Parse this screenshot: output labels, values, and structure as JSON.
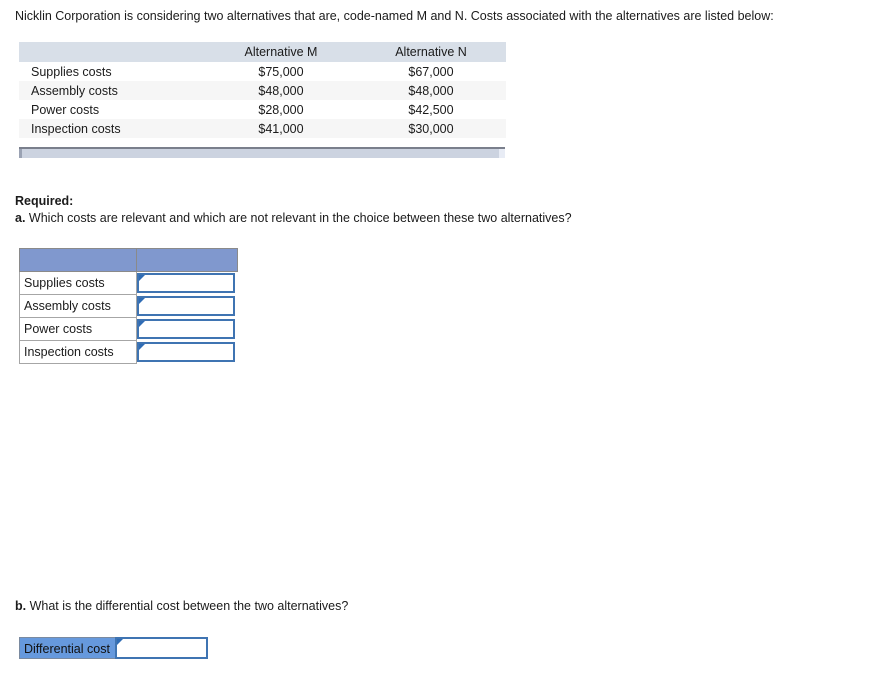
{
  "intro": {
    "text": "Nicklin Corporation is considering two alternatives that are, code-named M and N. Costs associated with the alternatives are listed below:"
  },
  "data_table": {
    "columns": [
      "",
      "Alternative M",
      "Alternative N"
    ],
    "rows": [
      {
        "label": "Supplies costs",
        "m": "$75,000",
        "n": "$67,000"
      },
      {
        "label": "Assembly costs",
        "m": "$48,000",
        "n": "$48,000"
      },
      {
        "label": "Power costs",
        "m": "$28,000",
        "n": "$42,500"
      },
      {
        "label": "Inspection costs",
        "m": "$41,000",
        "n": "$30,000"
      }
    ]
  },
  "scrollbar": {
    "name": "horizontal-scrollbar"
  },
  "required": {
    "heading": "Required:",
    "question_a_letter": "a.",
    "question_a_text": " Which costs are relevant and which are not relevant in the choice between these two alternatives?",
    "question_b_letter": "b.",
    "question_b_text": " What is the differential cost between the two alternatives?"
  },
  "answer_table": {
    "header": {
      "col1": "",
      "col2": ""
    },
    "rows": [
      {
        "label": "Supplies costs",
        "value": "",
        "placeholder": ""
      },
      {
        "label": "Assembly costs",
        "value": "",
        "placeholder": ""
      },
      {
        "label": "Power costs",
        "value": "",
        "placeholder": ""
      },
      {
        "label": "Inspection costs",
        "value": "",
        "placeholder": ""
      }
    ]
  },
  "differential": {
    "label": "Differential cost",
    "value": "",
    "placeholder": ""
  },
  "colors": {
    "data_header_bg": "#d8dfe8",
    "data_row_alt_bg": "#f6f6f6",
    "answer_header_bg": "#8098ce",
    "differential_label_bg": "#6699dd",
    "input_border": "#3f74b2",
    "corner_flag": "#2f6cb5",
    "scrollbar_track": "#ccd3e0",
    "text": "#1b1b1b"
  }
}
